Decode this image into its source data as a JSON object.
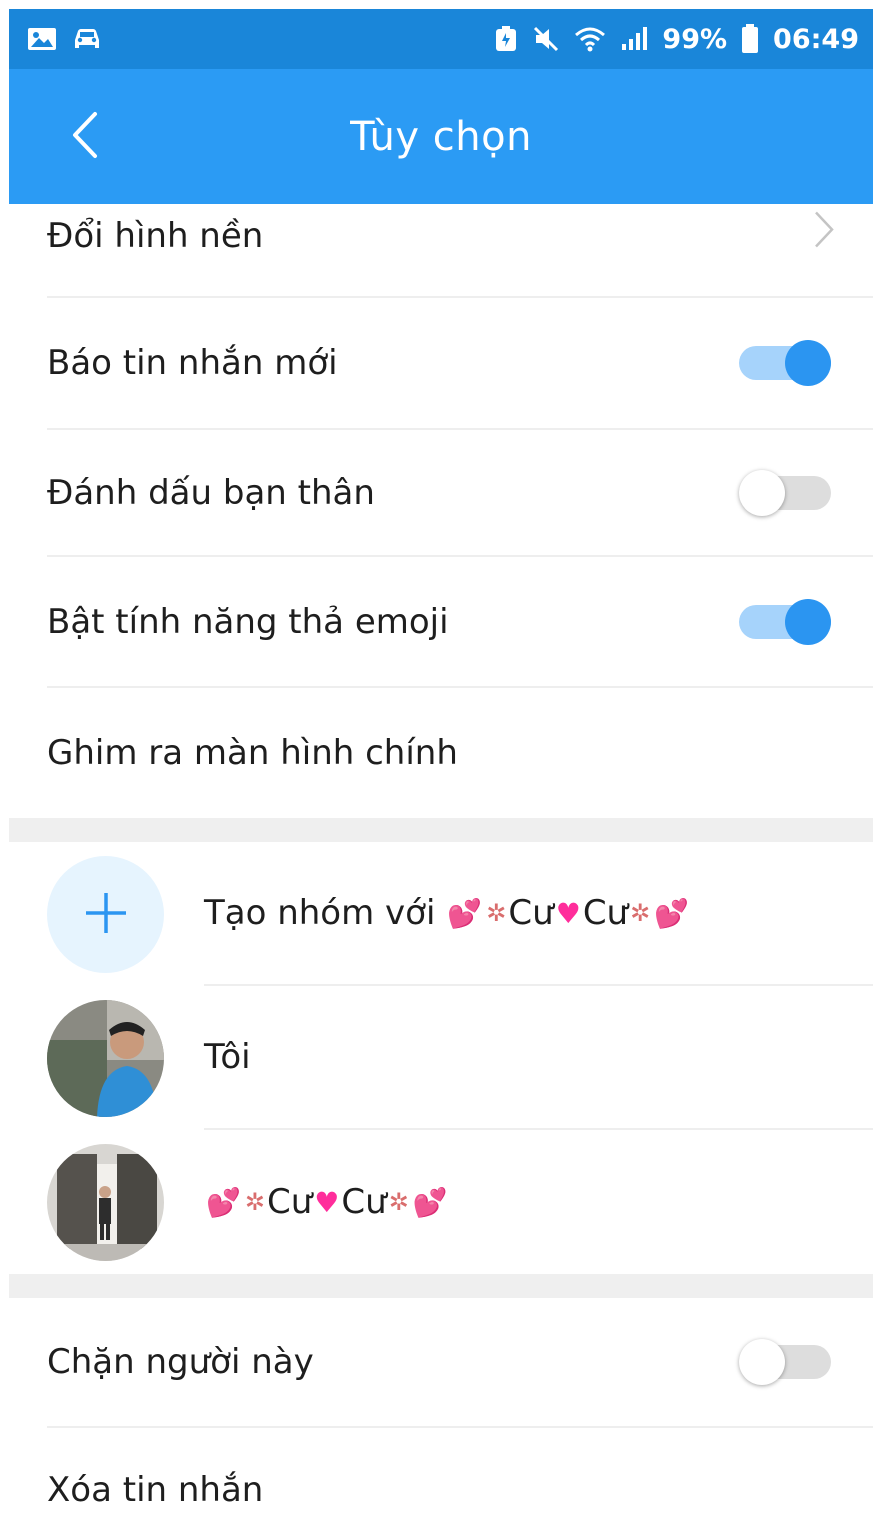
{
  "status_bar": {
    "battery_percent": "99%",
    "time": "06:49",
    "icons": [
      "gallery-icon",
      "car-icon",
      "battery-saver-icon",
      "mute-icon",
      "wifi-icon",
      "signal-icon",
      "battery-icon"
    ]
  },
  "app_bar": {
    "title": "Tùy chọn",
    "back_icon": "back-chevron-icon"
  },
  "settings": {
    "change_background": "Đổi hình nền",
    "new_message_alert": {
      "label": "Báo tin nhắn mới",
      "on": true
    },
    "mark_best_friend": {
      "label": "Đánh dấu bạn thân",
      "on": false
    },
    "emoji_reactions": {
      "label": "Bật tính năng thả emoji",
      "on": true
    },
    "pin_to_home": "Ghim ra màn hình chính"
  },
  "members": {
    "create_group_prefix": "Tạo nhóm với",
    "contact_name_text": "Cư",
    "self_name": "Tôi"
  },
  "bottom": {
    "block_user": {
      "label": "Chặn người này",
      "on": false
    },
    "delete_messages": "Xóa tin nhắn"
  },
  "colors": {
    "status_bar": "#1a86d9",
    "app_bar": "#2b9bf4",
    "toggle_on": "#2b95f1",
    "toggle_track_on": "#a6d3fb",
    "toggle_off_track": "#dddddd"
  }
}
